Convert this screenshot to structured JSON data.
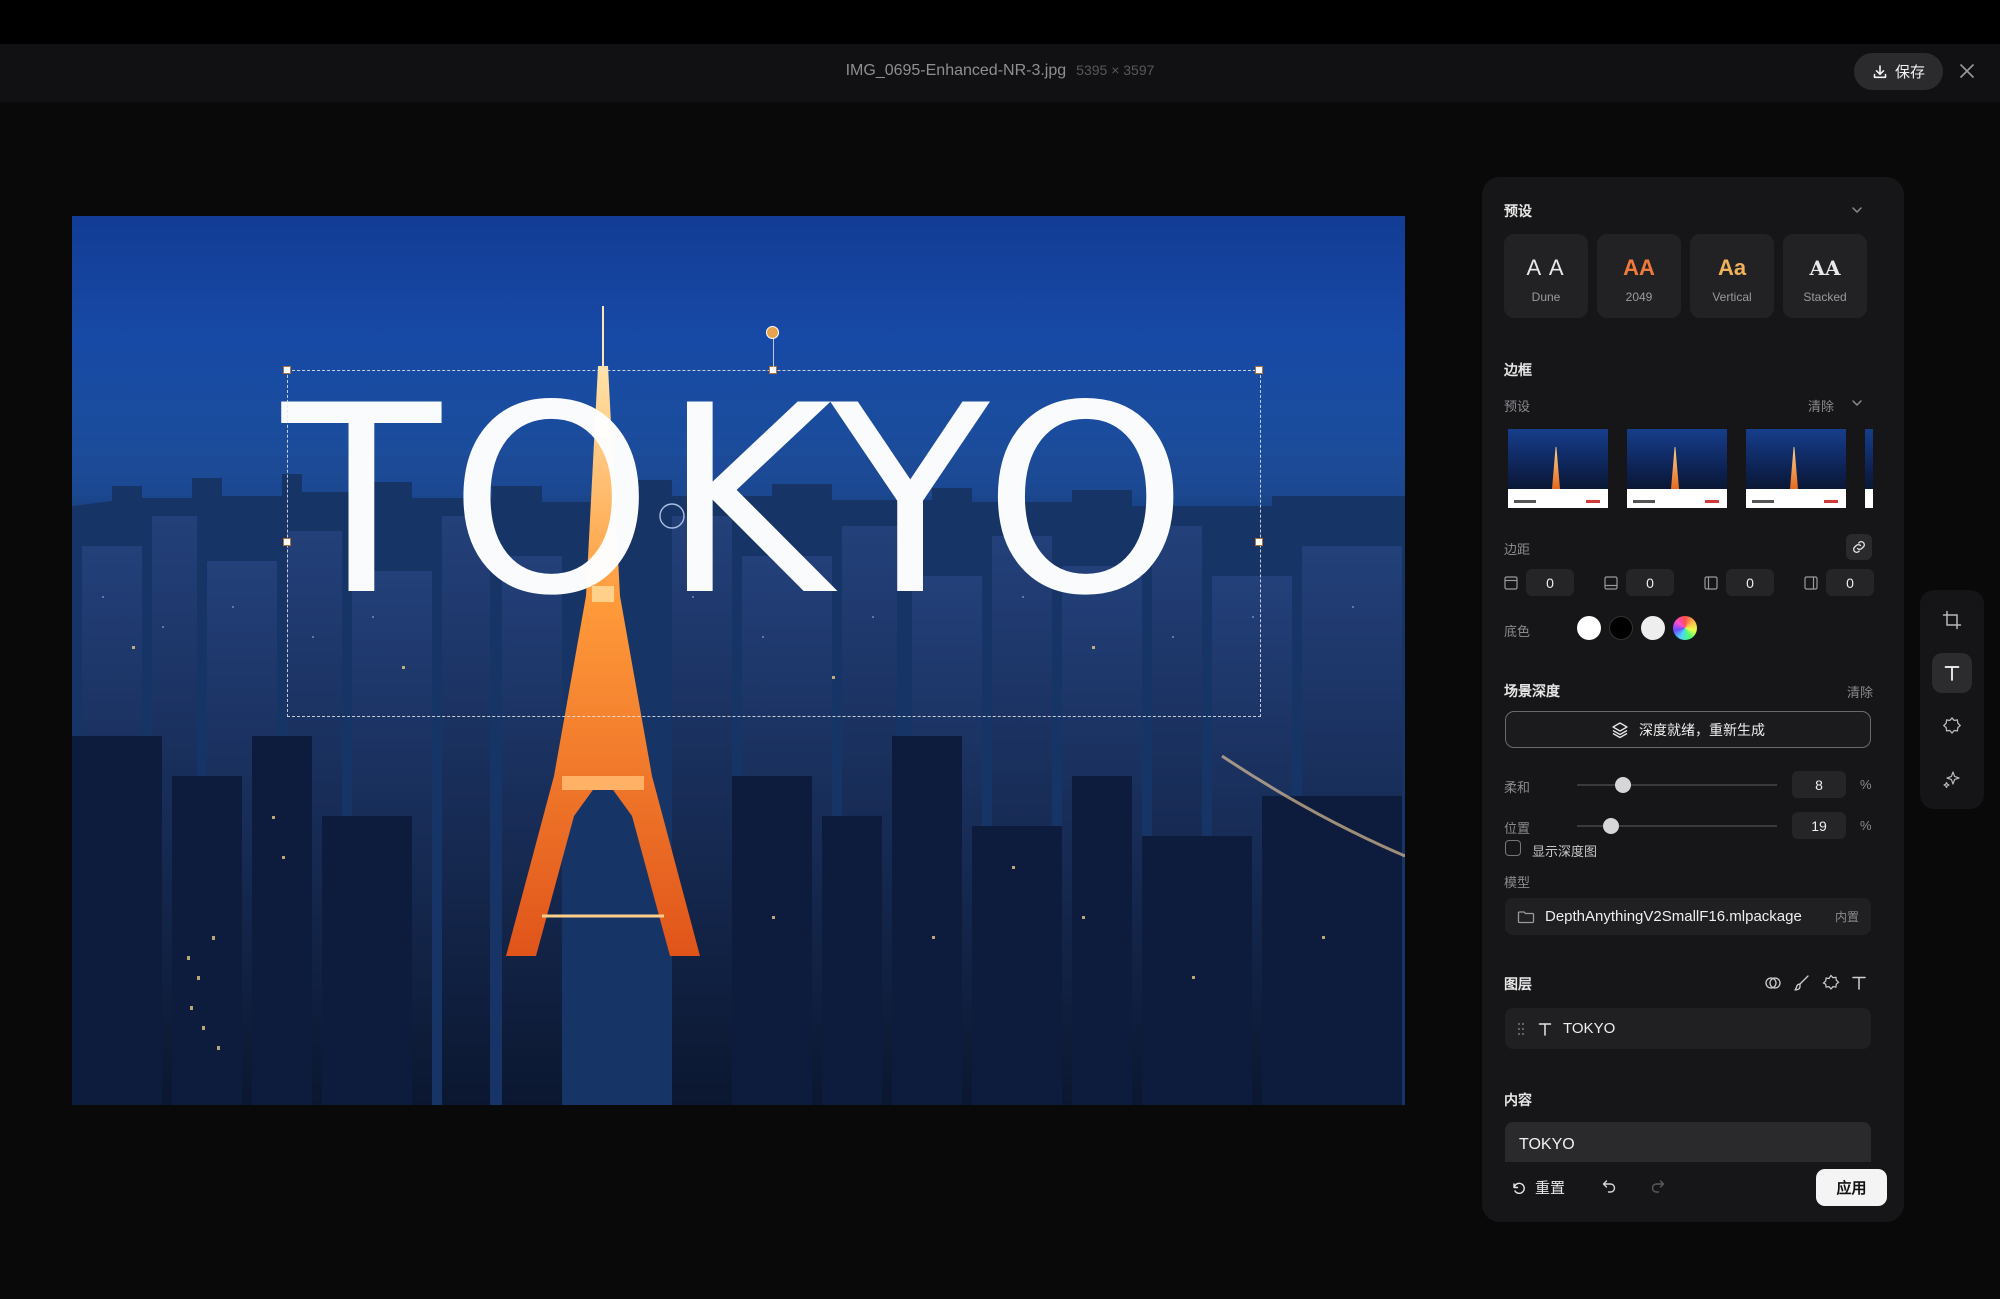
{
  "titlebar": {
    "filename": "IMG_0695-Enhanced-NR-3.jpg",
    "dimensions": "5395 × 3597",
    "save_label": "保存"
  },
  "canvas": {
    "text_layer": "TOKYO"
  },
  "panel": {
    "presets": {
      "heading": "预设",
      "items": [
        {
          "glyph": "A A",
          "name": "Dune",
          "color": "#e6e6e6"
        },
        {
          "glyph": "AA",
          "name": "2049",
          "color": "#f07a3c"
        },
        {
          "glyph": "Aa",
          "name": "Vertical",
          "color": "#f0b25a"
        },
        {
          "glyph": "AA",
          "name": "Stacked",
          "color": "#ffffff"
        }
      ]
    },
    "border": {
      "heading": "边框",
      "preset_label": "预设",
      "clear_label": "清除",
      "margin_label": "边距",
      "margins": [
        "0",
        "0",
        "0",
        "0"
      ],
      "base_color_label": "底色",
      "swatches": [
        "#ffffff",
        "#000000",
        "#eeeeee",
        "rainbow"
      ]
    },
    "depth": {
      "heading": "场景深度",
      "clear_label": "清除",
      "regenerate_label": "深度就绪，重新生成",
      "softness_label": "柔和",
      "softness_value": "8",
      "softness_unit": "%",
      "softness_fraction": 0.23,
      "position_label": "位置",
      "position_value": "19",
      "position_unit": "%",
      "position_fraction": 0.17,
      "show_depth_label": "显示深度图",
      "model_label": "模型",
      "model_name": "DepthAnythingV2SmallF16.mlpackage",
      "model_badge": "内置"
    },
    "layers": {
      "heading": "图层",
      "items": [
        {
          "type": "text",
          "name": "TOKYO"
        }
      ]
    },
    "content": {
      "heading": "内容",
      "value": "TOKYO"
    },
    "footer": {
      "reset_label": "重置",
      "apply_label": "应用"
    }
  },
  "rail": {
    "tools": [
      "crop-icon",
      "text-icon",
      "badge-icon",
      "sparkle-icon"
    ],
    "active": "text-icon"
  }
}
